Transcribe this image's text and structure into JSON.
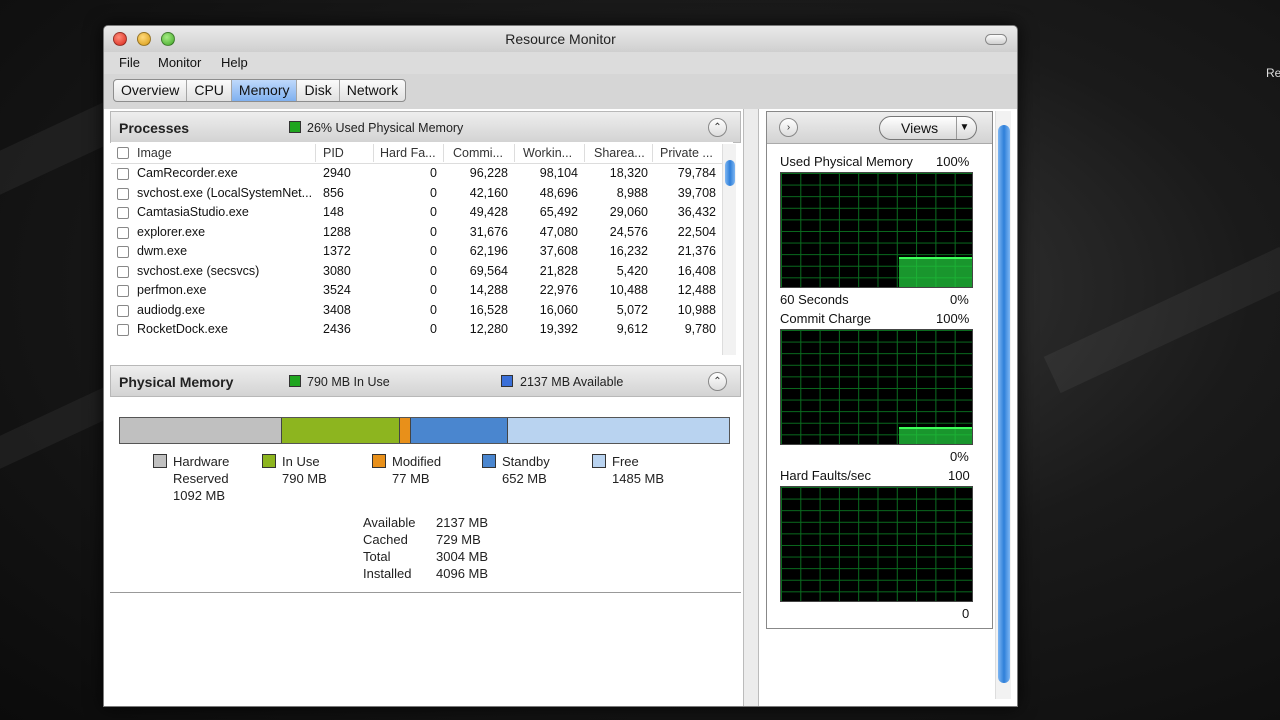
{
  "window": {
    "title": "Resource Monitor"
  },
  "desktop_text": "Re",
  "menu": [
    "File",
    "Monitor",
    "Help"
  ],
  "tabs": [
    {
      "label": "Overview",
      "active": false
    },
    {
      "label": "CPU",
      "active": false
    },
    {
      "label": "Memory",
      "active": true
    },
    {
      "label": "Disk",
      "active": false
    },
    {
      "label": "Network",
      "active": false
    }
  ],
  "processes": {
    "title": "Processes",
    "status": "26% Used Physical Memory",
    "status_color": "#1fa51f",
    "columns": [
      "Image",
      "PID",
      "Hard Fa...",
      "Commi...",
      "Workin...",
      "Sharea...",
      "Private ..."
    ],
    "rows": [
      {
        "image": "CamRecorder.exe",
        "pid": "2940",
        "hard": "0",
        "commit": "96,228",
        "working": "98,104",
        "share": "18,320",
        "private": "79,784"
      },
      {
        "image": "svchost.exe (LocalSystemNet...",
        "pid": "856",
        "hard": "0",
        "commit": "42,160",
        "working": "48,696",
        "share": "8,988",
        "private": "39,708"
      },
      {
        "image": "CamtasiaStudio.exe",
        "pid": "148",
        "hard": "0",
        "commit": "49,428",
        "working": "65,492",
        "share": "29,060",
        "private": "36,432"
      },
      {
        "image": "explorer.exe",
        "pid": "1288",
        "hard": "0",
        "commit": "31,676",
        "working": "47,080",
        "share": "24,576",
        "private": "22,504"
      },
      {
        "image": "dwm.exe",
        "pid": "1372",
        "hard": "0",
        "commit": "62,196",
        "working": "37,608",
        "share": "16,232",
        "private": "21,376"
      },
      {
        "image": "svchost.exe (secsvcs)",
        "pid": "3080",
        "hard": "0",
        "commit": "69,564",
        "working": "21,828",
        "share": "5,420",
        "private": "16,408"
      },
      {
        "image": "perfmon.exe",
        "pid": "3524",
        "hard": "0",
        "commit": "14,288",
        "working": "22,976",
        "share": "10,488",
        "private": "12,488"
      },
      {
        "image": "audiodg.exe",
        "pid": "3408",
        "hard": "0",
        "commit": "16,528",
        "working": "16,060",
        "share": "5,072",
        "private": "10,988"
      },
      {
        "image": "RocketDock.exe",
        "pid": "2436",
        "hard": "0",
        "commit": "12,280",
        "working": "19,392",
        "share": "9,612",
        "private": "9,780"
      }
    ]
  },
  "physical": {
    "title": "Physical Memory",
    "in_use": "790 MB In Use",
    "available": "2137 MB Available",
    "segments": [
      {
        "name": "Hardware Reserved",
        "line1": "Hardware",
        "line2": "Reserved",
        "value": "1092 MB",
        "mb": 1092,
        "color": "#c0c0c0"
      },
      {
        "name": "In Use",
        "line1": "In Use",
        "line2": "",
        "value": "790 MB",
        "mb": 790,
        "color": "#8db51f"
      },
      {
        "name": "Modified",
        "line1": "Modified",
        "line2": "",
        "value": "77 MB",
        "mb": 77,
        "color": "#e8901a"
      },
      {
        "name": "Standby",
        "line1": "Standby",
        "line2": "",
        "value": "652 MB",
        "mb": 652,
        "color": "#4a86cf"
      },
      {
        "name": "Free",
        "line1": "Free",
        "line2": "",
        "value": "1485 MB",
        "mb": 1485,
        "color": "#b9d3f0"
      }
    ],
    "stats": [
      {
        "label": "Available",
        "value": "2137 MB"
      },
      {
        "label": "Cached",
        "value": "729 MB"
      },
      {
        "label": "Total",
        "value": "3004 MB"
      },
      {
        "label": "Installed",
        "value": "4096 MB"
      }
    ]
  },
  "graphs": {
    "views_label": "Views",
    "g1": {
      "label": "Used Physical Memory",
      "max": "100%",
      "time": "60 Seconds",
      "min": "0%",
      "level": 0.26
    },
    "g2": {
      "label": "Commit Charge",
      "max": "100%",
      "min": "0%",
      "level": 0.15
    },
    "g3": {
      "label": "Hard Faults/sec",
      "max": "100",
      "min": "0",
      "level": 0.0
    }
  }
}
